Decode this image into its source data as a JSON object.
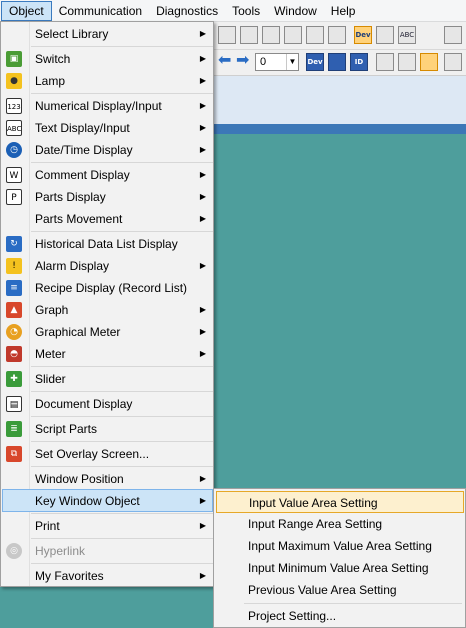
{
  "menubar": {
    "items": [
      {
        "label": "Object",
        "active": true
      },
      {
        "label": "Communication"
      },
      {
        "label": "Diagnostics"
      },
      {
        "label": "Tools"
      },
      {
        "label": "Window"
      },
      {
        "label": "Help"
      }
    ]
  },
  "toolbar": {
    "zoom_value": "0",
    "dev_label": "Dev",
    "id_label": "ID",
    "abc_label": "ABC"
  },
  "object_menu": {
    "items": [
      {
        "label": "Select Library",
        "submenu": true,
        "icon": ""
      },
      {
        "label": "Switch",
        "submenu": true,
        "icon": "switch-icon"
      },
      {
        "label": "Lamp",
        "submenu": true,
        "icon": "lamp-icon"
      },
      {
        "label": "Numerical Display/Input",
        "submenu": true,
        "icon": "numeric-display-icon"
      },
      {
        "label": "Text Display/Input",
        "submenu": true,
        "icon": "text-display-icon"
      },
      {
        "label": "Date/Time Display",
        "submenu": true,
        "icon": "clock-icon"
      },
      {
        "label": "Comment Display",
        "submenu": true,
        "icon": "comment-icon"
      },
      {
        "label": "Parts Display",
        "submenu": true,
        "icon": "parts-display-icon"
      },
      {
        "label": "Parts Movement",
        "submenu": true,
        "icon": ""
      },
      {
        "label": "Historical Data List Display",
        "submenu": false,
        "icon": "historical-data-icon"
      },
      {
        "label": "Alarm Display",
        "submenu": true,
        "icon": "alarm-icon"
      },
      {
        "label": "Recipe Display (Record List)",
        "submenu": false,
        "icon": "recipe-icon"
      },
      {
        "label": "Graph",
        "submenu": true,
        "icon": "graph-icon"
      },
      {
        "label": "Graphical Meter",
        "submenu": true,
        "icon": "graphical-meter-icon"
      },
      {
        "label": "Meter",
        "submenu": true,
        "icon": "meter-icon"
      },
      {
        "label": "Slider",
        "submenu": false,
        "icon": "slider-icon"
      },
      {
        "label": "Document Display",
        "submenu": false,
        "icon": "document-icon"
      },
      {
        "label": "Script Parts",
        "submenu": false,
        "icon": "script-icon"
      },
      {
        "label": "Set Overlay Screen...",
        "submenu": false,
        "icon": "overlay-icon"
      },
      {
        "label": "Window Position",
        "submenu": true,
        "icon": ""
      },
      {
        "label": "Key Window Object",
        "submenu": true,
        "icon": "",
        "highlighted": true
      },
      {
        "label": "Print",
        "submenu": true,
        "icon": ""
      },
      {
        "label": "Hyperlink",
        "submenu": false,
        "icon": "hyperlink-icon",
        "disabled": true
      },
      {
        "label": "My Favorites",
        "submenu": true,
        "icon": ""
      }
    ]
  },
  "key_window_submenu": {
    "items": [
      {
        "label": "Input Value Area Setting",
        "highlighted": true
      },
      {
        "label": "Input Range Area Setting"
      },
      {
        "label": "Input Maximum Value Area Setting"
      },
      {
        "label": "Input Minimum Value Area Setting"
      },
      {
        "label": "Previous Value Area Setting"
      },
      {
        "label": "Project Setting..."
      }
    ]
  },
  "colors": {
    "canvas": "#4e9e9c",
    "menu_highlight": "#cce4f7",
    "submenu_highlight": "#fdf0cf",
    "submenu_highlight_border": "#e6a828"
  }
}
